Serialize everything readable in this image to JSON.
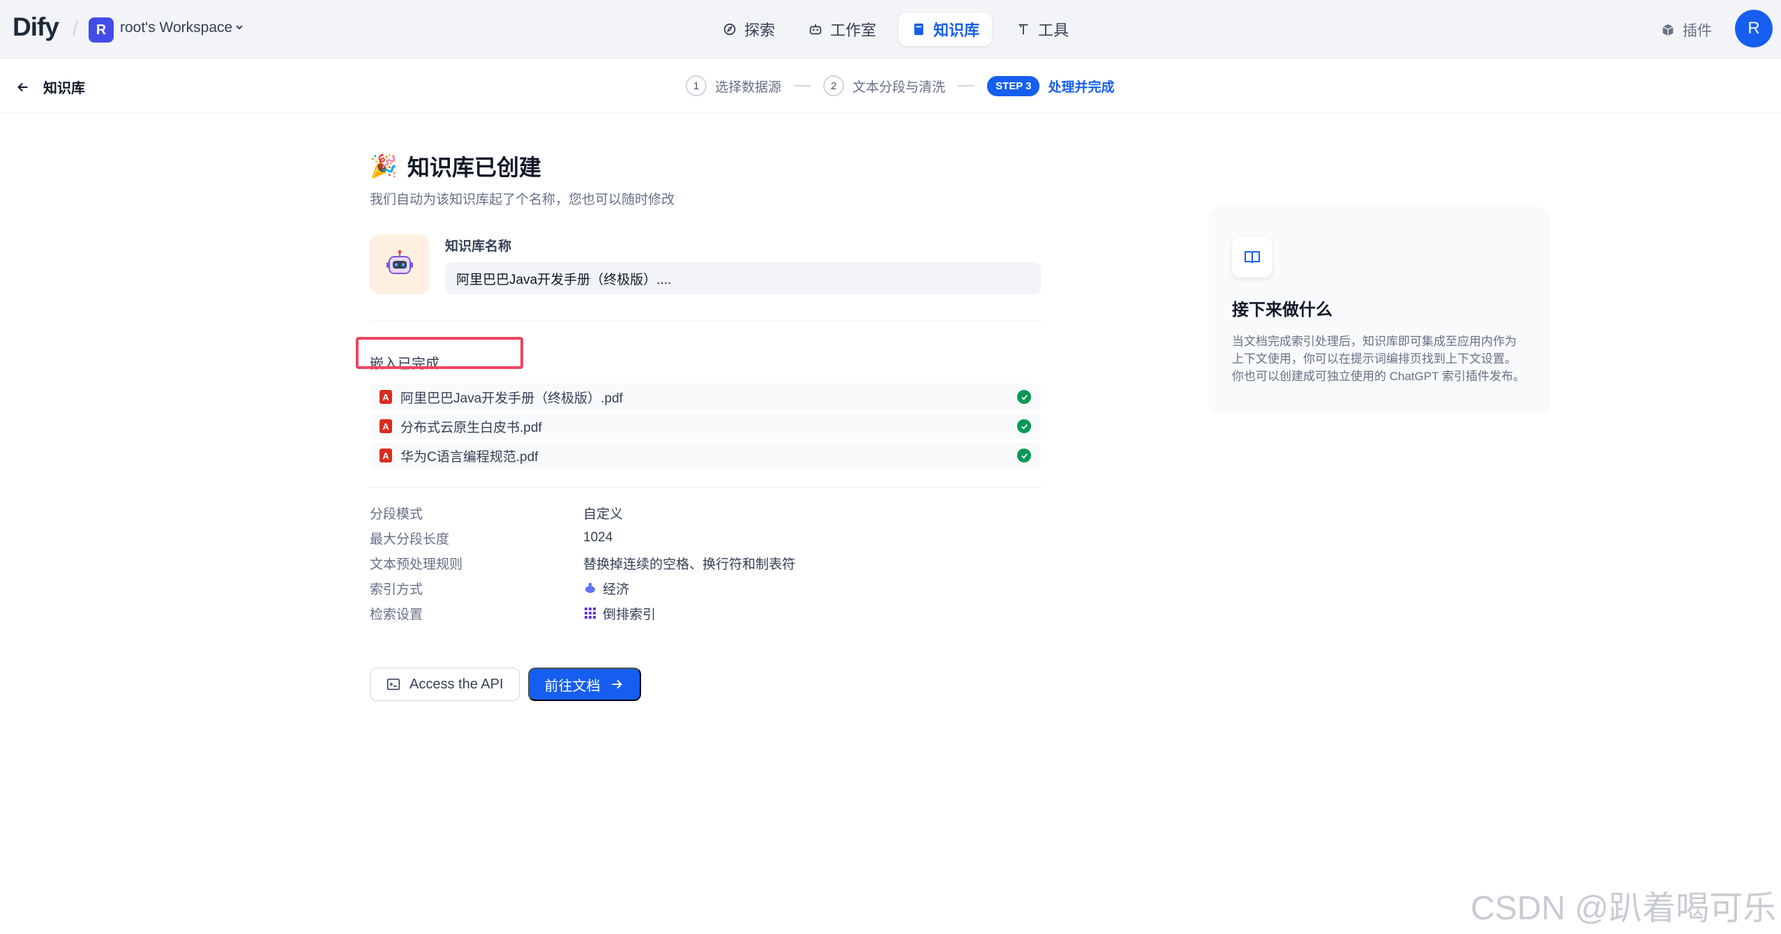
{
  "app": {
    "logo": "Dify",
    "workspace_initial": "R",
    "workspace_name": "root's Workspace",
    "user_initial": "R"
  },
  "nav": {
    "explore": "探索",
    "studio": "工作室",
    "knowledge": "知识库",
    "tools": "工具",
    "plugins": "插件"
  },
  "subheader": {
    "back_label": "知识库",
    "steps": [
      {
        "num": "1",
        "label": "选择数据源"
      },
      {
        "num": "2",
        "label": "文本分段与清洗"
      },
      {
        "badge": "STEP 3",
        "label": "处理并完成"
      }
    ]
  },
  "main": {
    "title": "知识库已创建",
    "subtitle": "我们自动为该知识库起了个名称，您也可以随时修改",
    "name_label": "知识库名称",
    "name_value": "阿里巴巴Java开发手册（终极版）....",
    "embed_label": "嵌入已完成",
    "files": [
      "阿里巴巴Java开发手册（终极版）.pdf",
      "分布式云原生白皮书.pdf",
      "华为C语言编程规范.pdf"
    ],
    "info": [
      {
        "key": "分段模式",
        "value": "自定义"
      },
      {
        "key": "最大分段长度",
        "value": "1024"
      },
      {
        "key": "文本预处理规则",
        "value": "替换掉连续的空格、换行符和制表符"
      },
      {
        "key": "索引方式",
        "value": "经济",
        "icon": "piggy-bank-icon"
      },
      {
        "key": "检索设置",
        "value": "倒排索引",
        "icon": "grid-icon"
      }
    ],
    "api_button": "Access the API",
    "go_button": "前往文档"
  },
  "tip": {
    "title": "接下来做什么",
    "text": "当文档完成索引处理后，知识库即可集成至应用内作为上下文使用，你可以在提示词编排页找到上下文设置。你也可以创建成可独立使用的 ChatGPT 索引插件发布。"
  },
  "watermark": "CSDN @趴着喝可乐",
  "colors": {
    "accent": "#155eef",
    "success": "#039855",
    "highlight": "#f04461"
  }
}
